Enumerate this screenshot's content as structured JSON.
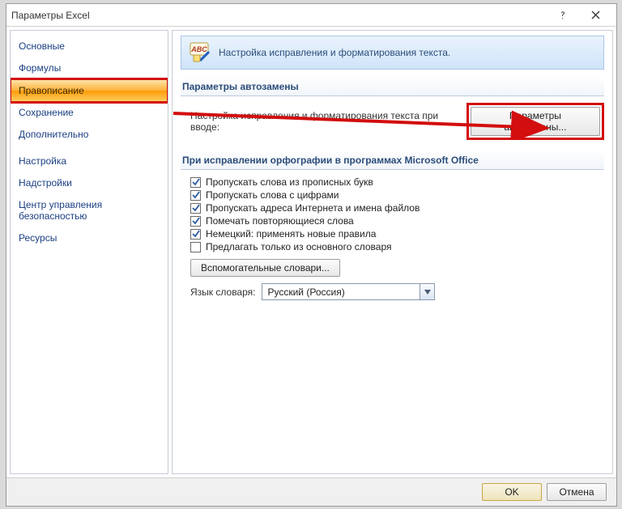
{
  "titlebar": {
    "title": "Параметры Excel"
  },
  "sidebar": {
    "items": [
      {
        "label": "Основные"
      },
      {
        "label": "Формулы"
      },
      {
        "label": "Правописание"
      },
      {
        "label": "Сохранение"
      },
      {
        "label": "Дополнительно"
      },
      {
        "label": "Настройка"
      },
      {
        "label": "Надстройки"
      },
      {
        "label": "Центр управления безопасностью"
      },
      {
        "label": "Ресурсы"
      }
    ]
  },
  "banner": {
    "text": "Настройка исправления и форматирования текста.",
    "icon_label": "ABC"
  },
  "group1": {
    "title": "Параметры автозамены",
    "caption": "Настройка исправления и форматирования текста при вводе:",
    "button": "Параметры автозамены..."
  },
  "group2": {
    "title": "При исправлении орфографии в программах Microsoft Office",
    "checks": [
      {
        "label": "Пропускать слова из прописных букв",
        "checked": true
      },
      {
        "label": "Пропускать слова с цифрами",
        "checked": true
      },
      {
        "label": "Пропускать адреса Интернета и имена файлов",
        "checked": true
      },
      {
        "label": "Помечать повторяющиеся слова",
        "checked": true
      },
      {
        "label": "Немецкий: применять новые правила",
        "checked": true
      },
      {
        "label": "Предлагать только из основного словаря",
        "checked": false
      }
    ],
    "dict_button": "Вспомогательные словари...",
    "lang_label": "Язык словаря:",
    "lang_value": "Русский (Россия)"
  },
  "footer": {
    "ok": "OK",
    "cancel": "Отмена"
  }
}
